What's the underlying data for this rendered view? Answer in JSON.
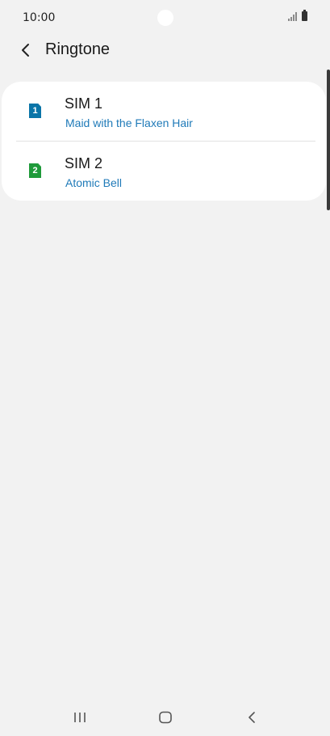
{
  "status_bar": {
    "time": "10:00",
    "icons": [
      "signal-icon",
      "battery-icon"
    ]
  },
  "header": {
    "back_icon": "chevron-left-icon",
    "title": "Ringtone"
  },
  "sim_list": [
    {
      "sim_badge": "1",
      "title": "SIM 1",
      "ringtone": "Maid with the Flaxen Hair",
      "badge_color": "#0a75a8"
    },
    {
      "sim_badge": "2",
      "title": "SIM 2",
      "ringtone": "Atomic Bell",
      "badge_color": "#1f9a3a"
    }
  ],
  "nav_bar": {
    "icons": [
      "recents-icon",
      "home-icon",
      "back-icon"
    ]
  },
  "colors": {
    "background": "#f2f2f2",
    "card": "#ffffff",
    "accent_text": "#1f7ab8"
  }
}
